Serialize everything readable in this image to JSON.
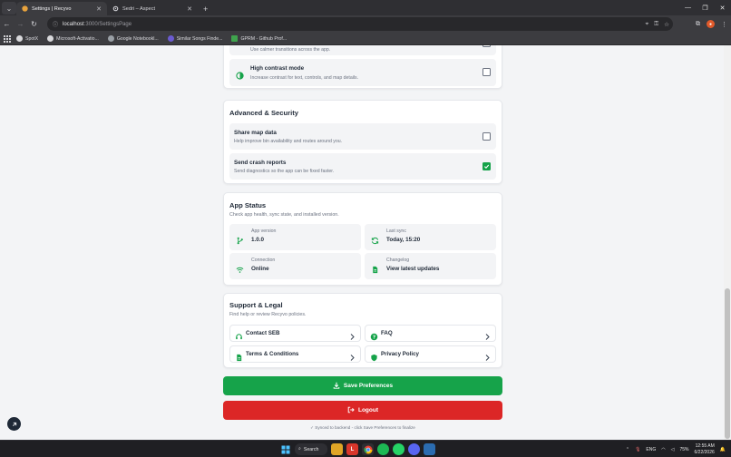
{
  "browser": {
    "tabs": [
      {
        "title": "Settings | Recyvo",
        "active": true
      },
      {
        "title": "Sedri – Aspect",
        "active": false
      }
    ],
    "url_host": "localhost",
    "url_path": ":3000/SettingsPage",
    "bookmarks": [
      "SpotX",
      "Microsoft-Activatio...",
      "Google Notebookl...",
      "Similar Songs Finde...",
      "GPRM - Github Prof..."
    ]
  },
  "accessibility": {
    "reduce_motion_desc": "Use calmer transitions across the app.",
    "high_contrast_label": "High contrast mode",
    "high_contrast_desc": "Increase contrast for text, controls, and map details.",
    "high_contrast_checked": false,
    "reduce_motion_checked": false
  },
  "advanced": {
    "title": "Advanced & Security",
    "share_label": "Share map data",
    "share_desc": "Help improve bin availability and routes around you.",
    "share_checked": false,
    "crash_label": "Send crash reports",
    "crash_desc": "Send diagnostics so the app can be fixed faster.",
    "crash_checked": true
  },
  "app_status": {
    "title": "App Status",
    "subtitle": "Check app health, sync state, and installed version.",
    "version_label": "App version",
    "version_value": "1.0.0",
    "sync_label": "Last sync",
    "sync_value": "Today, 15:20",
    "connection_label": "Connection",
    "connection_value": "Online",
    "changelog_label": "Changelog",
    "changelog_value": "View latest updates"
  },
  "support": {
    "title": "Support & Legal",
    "subtitle": "Find help or review Recyvo policies.",
    "contact": "Contact SEB",
    "faq": "FAQ",
    "terms": "Terms & Conditions",
    "privacy": "Privacy Policy"
  },
  "actions": {
    "save": "Save Preferences",
    "logout": "Logout",
    "synced_note": "✓ Synced to backend - click Save Preferences to finalize"
  },
  "taskbar": {
    "search": "Search",
    "lang": "ENG",
    "battery": "75%",
    "time": "12:55 AM",
    "date": "6/22/2026"
  },
  "colors": {
    "accent_green": "#16a34a",
    "danger_red": "#dc2626",
    "card_bg": "#ffffff",
    "page_bg": "#f3f4f6"
  }
}
